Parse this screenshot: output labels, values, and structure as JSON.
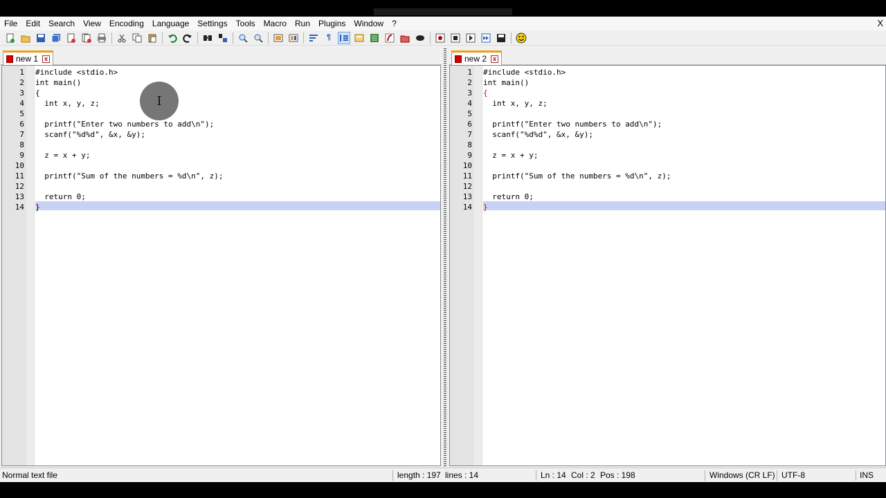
{
  "menu": [
    "File",
    "Edit",
    "Search",
    "View",
    "Encoding",
    "Language",
    "Settings",
    "Tools",
    "Macro",
    "Run",
    "Plugins",
    "Window",
    "?"
  ],
  "window_close": "X",
  "toolbar_icons": [
    "new-file-icon",
    "open-file-icon",
    "save-icon",
    "save-all-icon",
    "close-icon",
    "close-all-icon",
    "print-icon",
    "cut-icon",
    "copy-icon",
    "paste-icon",
    "undo-icon",
    "redo-icon",
    "find-icon",
    "replace-icon",
    "zoom-in-icon",
    "zoom-out-icon",
    "sync-vertical-icon",
    "sync-horizontal-icon",
    "word-wrap-icon",
    "show-all-chars-icon",
    "indent-guide-icon",
    "user-language-icon",
    "doc-map-icon",
    "function-list-icon",
    "folder-workspace-icon",
    "monitoring-icon",
    "record-macro-icon",
    "stop-macro-icon",
    "play-macro-icon",
    "run-macro-multiple-icon",
    "save-macro-icon",
    "smiley-icon"
  ],
  "left_tab": {
    "label": "new 1",
    "close": "x"
  },
  "right_tab": {
    "label": "new 2",
    "close": "x"
  },
  "line_numbers": [
    "1",
    "2",
    "3",
    "4",
    "5",
    "6",
    "7",
    "8",
    "9",
    "10",
    "11",
    "12",
    "13",
    "14"
  ],
  "code_lines": [
    "#include <stdio.h>",
    "int main()",
    "{",
    "  int x, y, z;",
    "",
    "  printf(\"Enter two numbers to add\\n\");",
    "  scanf(\"%d%d\", &x, &y);",
    "",
    "  z = x + y;",
    "",
    "  printf(\"Sum of the numbers = %d\\n\", z);",
    "",
    "  return 0;",
    "}"
  ],
  "cursor_glyph": "I",
  "status": {
    "file_type": "Normal text file",
    "length": "length : 197",
    "lines": "lines : 14",
    "ln": "Ln : 14",
    "col": "Col : 2",
    "pos": "Pos : 198",
    "eol": "Windows (CR LF)",
    "encoding": "UTF-8",
    "mode": "INS"
  },
  "colors": {
    "current_line": "#c8d2f5",
    "tab_accent": "#f39c12",
    "brace_match": "#e00000"
  }
}
